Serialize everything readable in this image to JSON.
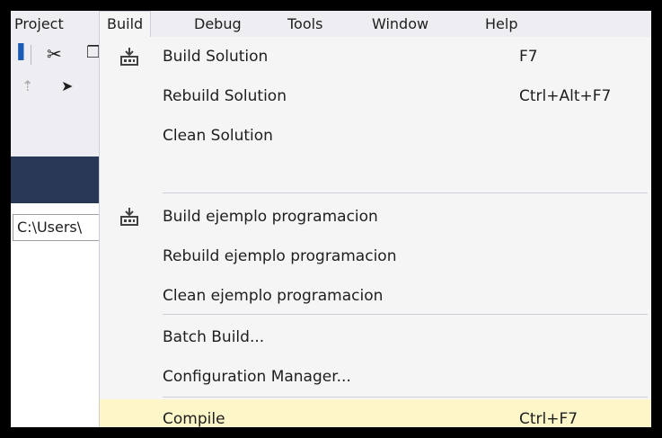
{
  "menubar": {
    "items": [
      {
        "label": "Project"
      },
      {
        "label": "Build"
      },
      {
        "label": "Debug"
      },
      {
        "label": "Tools"
      },
      {
        "label": "Window"
      },
      {
        "label": "Help"
      }
    ]
  },
  "toolbar": {
    "icons": [
      "cut-icon",
      "copy-icon",
      "pointer-icon",
      "up-arrow-icon"
    ]
  },
  "path_field": {
    "value": "C:\\Users\\"
  },
  "build_menu": {
    "items": [
      {
        "label": "Build Solution",
        "shortcut": "F7",
        "icon": "build-icon"
      },
      {
        "label": "Rebuild Solution",
        "shortcut": "Ctrl+Alt+F7"
      },
      {
        "label": "Clean Solution",
        "shortcut": ""
      },
      {
        "label": "Build ejemplo programacion",
        "shortcut": "",
        "icon": "build-icon"
      },
      {
        "label": "Rebuild ejemplo programacion",
        "shortcut": ""
      },
      {
        "label": "Clean ejemplo programacion",
        "shortcut": ""
      },
      {
        "label": "Batch Build...",
        "shortcut": ""
      },
      {
        "label": "Configuration Manager...",
        "shortcut": ""
      },
      {
        "label": "Compile",
        "shortcut": "Ctrl+F7"
      }
    ]
  },
  "colors": {
    "menu_background": "#f5f5f5",
    "highlight": "#fcf6c8",
    "accent_dark": "#293955"
  }
}
